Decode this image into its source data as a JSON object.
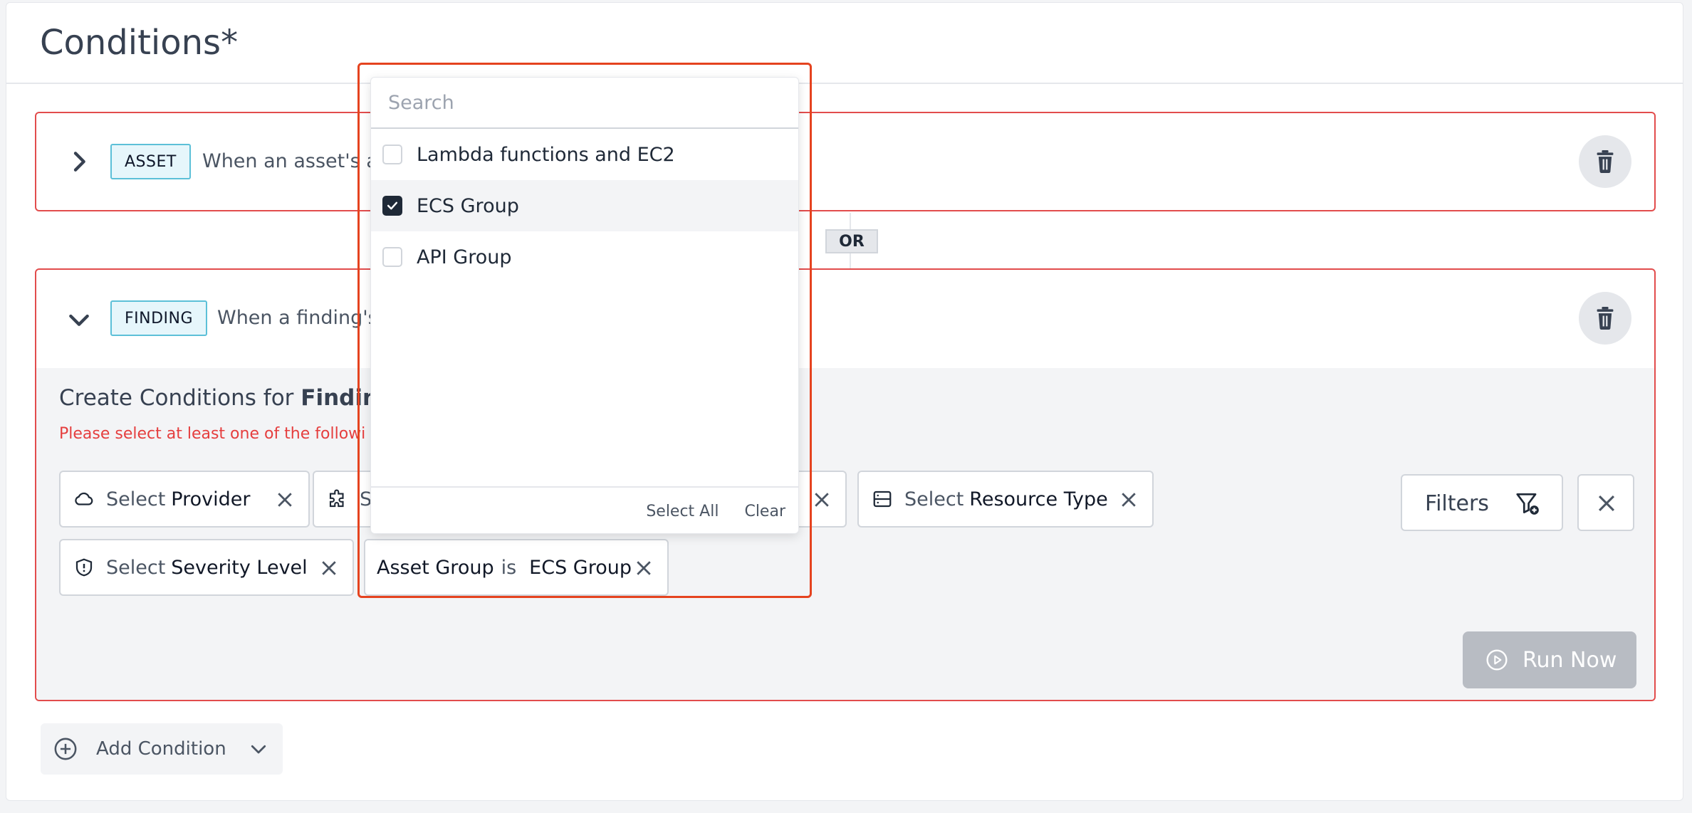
{
  "page": {
    "title": "Conditions*"
  },
  "conditions": {
    "asset": {
      "tag": "ASSET",
      "text": "When an asset's a"
    },
    "operator": "OR",
    "finding": {
      "tag": "FINDING",
      "text": "When a finding's",
      "body_title_prefix": "Create Conditions for ",
      "body_title_bold": "Finding",
      "error": "Please select at least one of the followi",
      "chips": {
        "provider": {
          "select": "Select",
          "label": "Provider"
        },
        "service": {
          "select": "S"
        },
        "resource_type": {
          "select": "Select",
          "label": "Resource Type"
        },
        "severity": {
          "select": "Select",
          "label": "Severity Level"
        },
        "asset_group": {
          "field": "Asset Group",
          "op": "is",
          "value": "ECS Group"
        }
      },
      "filters_label": "Filters",
      "run_now_label": "Run Now"
    }
  },
  "add_condition": {
    "label": "Add Condition"
  },
  "dropdown": {
    "search_placeholder": "Search",
    "options": [
      {
        "label": "Lambda functions and EC2",
        "checked": false
      },
      {
        "label": "ECS Group",
        "checked": true
      },
      {
        "label": "API Group",
        "checked": false
      }
    ],
    "select_all": "Select All",
    "clear": "Clear"
  },
  "colors": {
    "accent_red": "#e24c4c",
    "tag_border": "#5cc0d8",
    "run_disabled": "#b8bcc3"
  }
}
